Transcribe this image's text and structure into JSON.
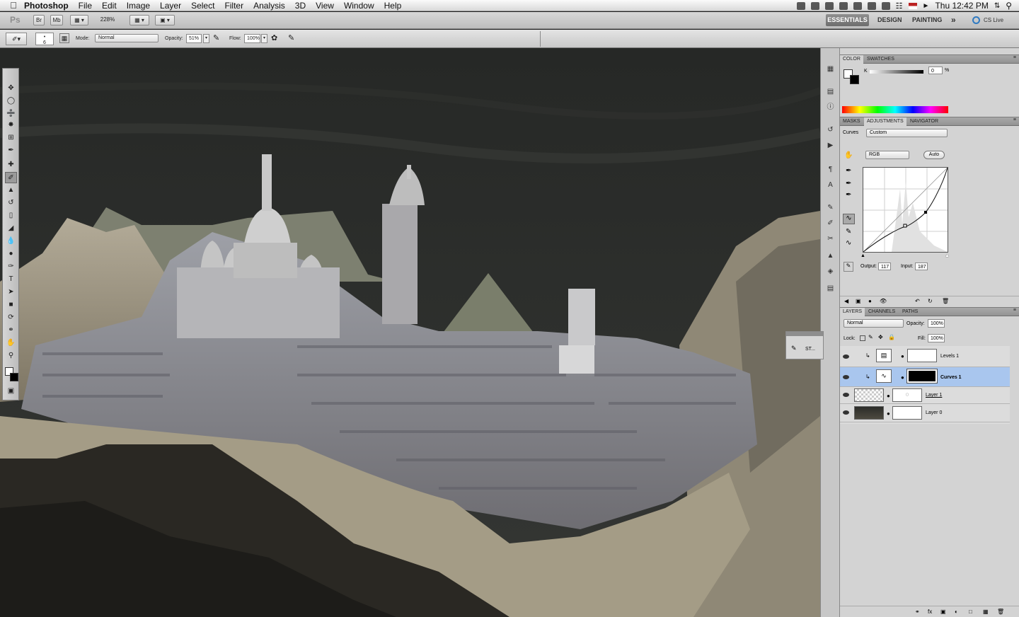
{
  "menubar": {
    "app": "Photoshop",
    "items": [
      "File",
      "Edit",
      "Image",
      "Layer",
      "Select",
      "Filter",
      "Analysis",
      "3D",
      "View",
      "Window",
      "Help"
    ],
    "clock": "Thu 12:42 PM"
  },
  "appbar": {
    "logo": "Ps",
    "br": "Br",
    "mb": "Mb",
    "zoom": "228%",
    "workspaces": [
      "ESSENTIALS",
      "DESIGN",
      "PAINTING"
    ],
    "more": "»",
    "cslive": "CS Live"
  },
  "options": {
    "brush_size": "6",
    "mode_label": "Mode:",
    "mode_value": "Normal",
    "opacity_label": "Opacity:",
    "opacity_value": "51%",
    "flow_label": "Flow:",
    "flow_value": "100%"
  },
  "color_panel": {
    "tabs": [
      "COLOR",
      "SWATCHES"
    ],
    "channel": "K",
    "value": "0",
    "unit": "%"
  },
  "adjust_panel": {
    "tabs": [
      "MASKS",
      "ADJUSTMENTS",
      "NAVIGATOR"
    ],
    "type_label": "Curves",
    "preset": "Custom",
    "channel": "RGB",
    "auto": "Auto",
    "output_label": "Output:",
    "output_value": "117",
    "input_label": "Input:",
    "input_value": "187"
  },
  "layers_panel": {
    "tabs": [
      "LAYERS",
      "CHANNELS",
      "PATHS"
    ],
    "blend": "Normal",
    "opacity_label": "Opacity:",
    "opacity_value": "100%",
    "lock_label": "Lock:",
    "fill_label": "Fill:",
    "fill_value": "100%",
    "layers": [
      {
        "name": "Levels 1"
      },
      {
        "name": "Curves 1"
      },
      {
        "name": "Layer 1"
      },
      {
        "name": "Layer 0"
      }
    ]
  },
  "floating": {
    "label": "ST..."
  },
  "colors": {
    "selected_layer": "#a9c6ee",
    "accent": "#3d6fb4"
  }
}
